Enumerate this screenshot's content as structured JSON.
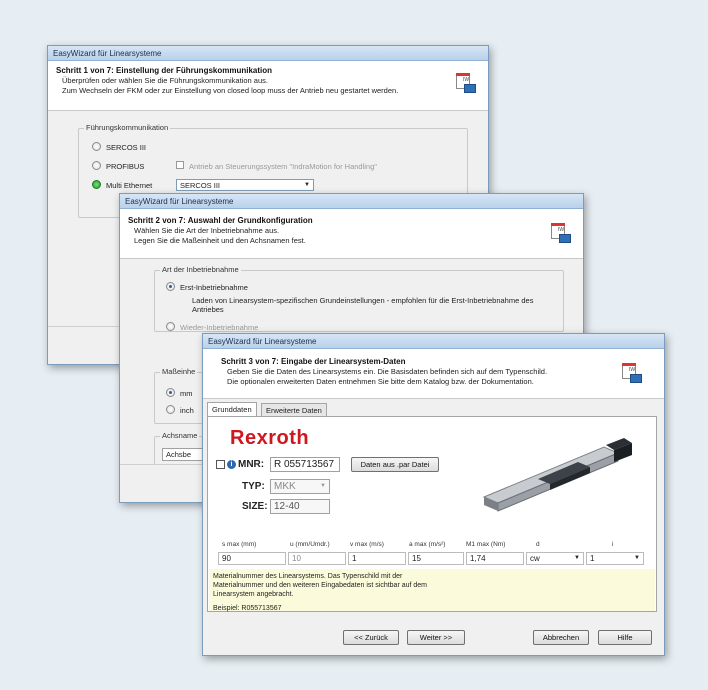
{
  "window1": {
    "title": "EasyWizard für Linearsysteme",
    "step_title": "Schritt 1 von 7: Einstellung der Führungskommunikation",
    "lines": [
      "Überprüfen oder wählen Sie die Führungskommunikation aus.",
      "Zum Wechseln der FKM oder zur Einstellung von closed loop muss der Antrieb neu gestartet werden."
    ],
    "group_label": "Führungskommunikation",
    "options": [
      "SERCOS III",
      "PROFIBUS",
      "Multi Ethernet"
    ],
    "checkbox_label": "Antrieb an Steuerungssystem \"IndraMotion for Handling\"",
    "select_value": "SERCOS III"
  },
  "window2": {
    "title": "EasyWizard für Linearsysteme",
    "step_title": "Schritt 2 von 7: Auswahl der Grundkonfiguration",
    "lines": [
      "Wählen Sie die Art der Inbetriebnahme aus.",
      "Legen Sie die Maßeinheit und den Achsnamen fest."
    ],
    "group_label": "Art der Inbetriebnahme",
    "option1": "Erst-Inbetriebnahme",
    "option1_desc": "Laden von Linearsystem-spezifischen Grundeinstellungen - empfohlen für die Erst-Inbetriebnahme des Antriebes",
    "option2": "Wieder-Inbetriebnahme",
    "unit_group_label": "Maßeinhe",
    "unit_options": [
      "mm",
      "inch"
    ],
    "axis_group_label": "Achsname",
    "axis_value": "Achsbe"
  },
  "window3": {
    "title": "EasyWizard für Linearsysteme",
    "step_title": "Schritt 3 von 7: Eingabe der Linearsystem-Daten",
    "lines": [
      "Geben Sie die Daten des Linearsystems ein. Die Basisdaten befinden sich auf dem Typenschild.",
      "Die optionalen erweiterten Daten entnehmen Sie bitte dem Katalog bzw. der Dokumentation."
    ],
    "tabs": [
      "Grunddaten",
      "Erweiterte Daten"
    ],
    "brand": "Rexroth",
    "mnr_label": "MNR:",
    "mnr_value": "R 055713567",
    "load_button": "Daten aus .par Datei",
    "typ_label": "TYP:",
    "typ_value": "MKK",
    "size_label": "SIZE:",
    "size_value": "12-40",
    "columns": [
      "s max (mm)",
      "u (mm/Umdr.)",
      "v max (m/s)",
      "a max (m/s²)",
      "M1 max (Nm)",
      "d",
      "i"
    ],
    "values": [
      "90",
      "10",
      "1",
      "15",
      "1,74",
      "cw",
      "1"
    ],
    "info_text": "Materialnummer des Linearsystems. Das Typenschild mit der Materialnummer und den weiteren Eingabedaten ist sichtbar auf dem Linearsystem angebracht.",
    "info_example": "Beispiel: R055713567",
    "buttons": {
      "back": "<< Zurück",
      "next": "Weiter >>",
      "cancel": "Abbrechen",
      "help": "Hilfe"
    }
  }
}
